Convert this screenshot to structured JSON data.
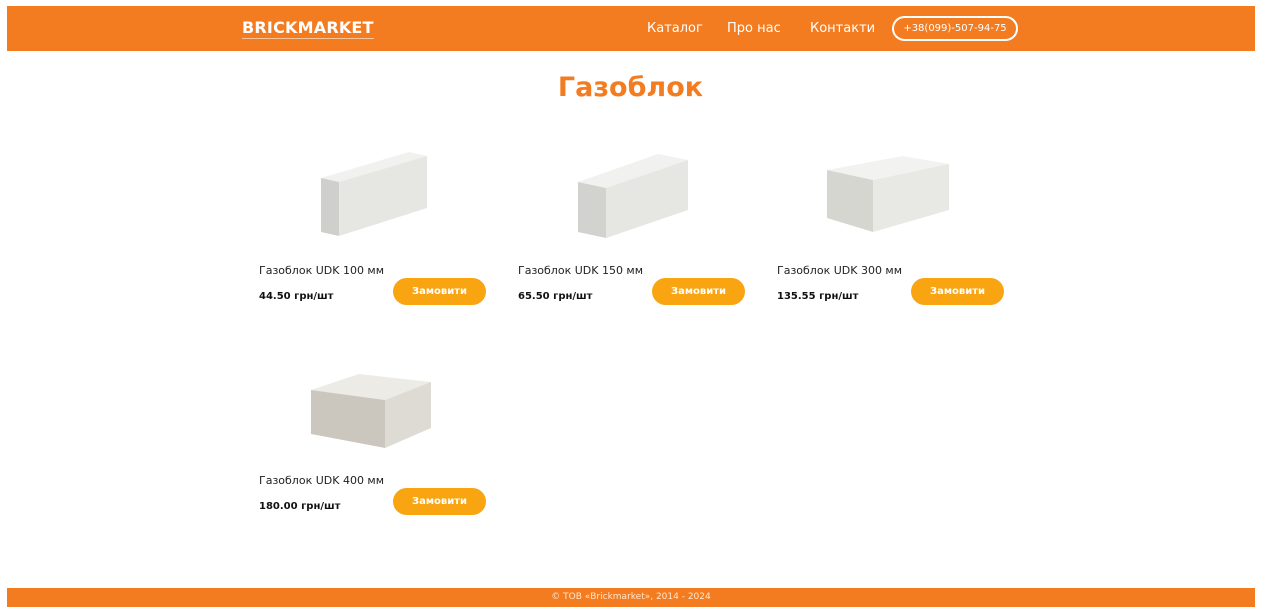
{
  "header": {
    "logo": "BRICKMARKET",
    "nav": {
      "catalog": "Каталог",
      "about": "Про нас",
      "contacts": "Контакти",
      "phone": "+38(099)-507-94-75"
    }
  },
  "page": {
    "title": "Газоблок"
  },
  "products": [
    {
      "name": "Газоблок UDK 100 мм",
      "price": "44.50 грн/шт",
      "button": "Замовити",
      "image": "gas-block-100mm-image"
    },
    {
      "name": "Газоблок UDK 150 мм",
      "price": "65.50 грн/шт",
      "button": "Замовити",
      "image": "gas-block-150mm-image"
    },
    {
      "name": "Газоблок UDK 300 мм",
      "price": "135.55 грн/шт",
      "button": "Замовити",
      "image": "gas-block-300mm-image"
    },
    {
      "name": "Газоблок UDK 400 мм",
      "price": "180.00 грн/шт",
      "button": "Замовити",
      "image": "gas-block-400mm-image"
    }
  ],
  "footer": {
    "copyright": "© ТОВ «Brickmarket», 2014 - 2024"
  },
  "colors": {
    "brand_orange": "#f47c20",
    "button_orange": "#f9a411",
    "background": "#ffffff"
  }
}
